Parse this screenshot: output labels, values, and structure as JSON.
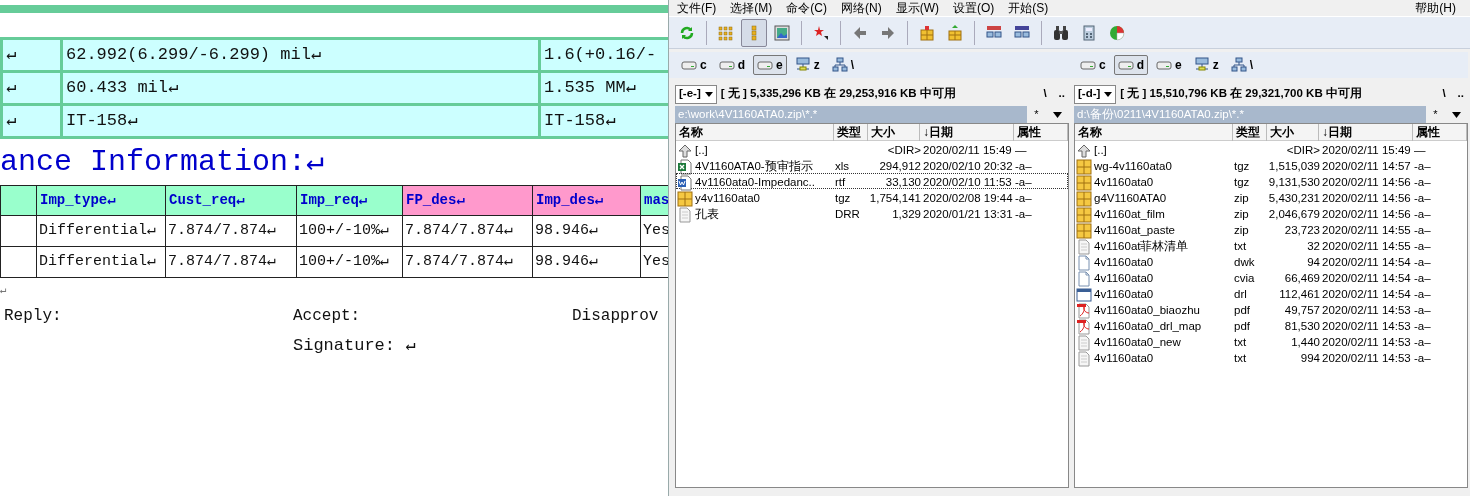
{
  "document": {
    "spec_rows": [
      {
        "cells": [
          "↵",
          "62.992(6.299/-6.299)  mil↵",
          "1.6(+0.16/-"
        ]
      },
      {
        "cells": [
          "↵",
          "60.433 mil↵",
          "1.535 MM↵"
        ]
      },
      {
        "cells": [
          "↵",
          "IT-158↵",
          "IT-158↵"
        ]
      }
    ],
    "heading": "ance Information:↵",
    "imp_table": {
      "columns": [
        {
          "label": "Imp_type↵",
          "color": "#99ffcc"
        },
        {
          "label": "Cust_req↵",
          "color": "#99ffcc"
        },
        {
          "label": "Imp_req↵",
          "color": "#99ffcc"
        },
        {
          "label": "FP_des↵",
          "color": "#ff99cc"
        },
        {
          "label": "Imp_des↵",
          "color": "#ff99cc"
        },
        {
          "label": "mas",
          "color": "#99ffcc"
        }
      ],
      "rows": [
        [
          "Differential↵",
          "7.874/7.874↵",
          "100+/-10%↵",
          "7.874/7.874↵",
          "98.946↵",
          "Yes"
        ],
        [
          "Differential↵",
          "7.874/7.874↵",
          "100+/-10%↵",
          "7.874/7.874↵",
          "98.946↵",
          "Yes"
        ]
      ]
    },
    "blank_line": "↵",
    "reply": [
      "Reply:",
      "Accept:",
      "Disapprov"
    ],
    "signature": "Signature: ↵"
  },
  "file_manager": {
    "menu": [
      "文件(F)",
      "选择(M)",
      "命令(C)",
      "网络(N)",
      "显示(W)",
      "设置(O)",
      "开始(S)"
    ],
    "help_menu": "帮助(H)",
    "toolbar": [
      [
        {
          "kind": "refresh",
          "selected": false
        }
      ],
      [
        {
          "kind": "grid",
          "selected": false
        },
        {
          "kind": "list",
          "selected": true
        },
        {
          "kind": "picture",
          "selected": false
        }
      ],
      [
        {
          "kind": "star",
          "selected": false
        }
      ],
      [
        {
          "kind": "back",
          "selected": false
        },
        {
          "kind": "forward",
          "selected": false
        }
      ],
      [
        {
          "kind": "pack",
          "selected": false
        },
        {
          "kind": "unpack",
          "selected": false
        }
      ],
      [
        {
          "kind": "ftp",
          "selected": false
        },
        {
          "kind": "url",
          "selected": false
        }
      ],
      [
        {
          "kind": "binoculars",
          "selected": false
        },
        {
          "kind": "calculator",
          "selected": false
        },
        {
          "kind": "pie",
          "selected": false
        }
      ]
    ],
    "panes": [
      {
        "drives": [
          {
            "letter": "c",
            "kind": "disk",
            "selected": false
          },
          {
            "letter": "d",
            "kind": "disk",
            "selected": false
          },
          {
            "letter": "e",
            "kind": "disk",
            "selected": true
          },
          {
            "letter": "z",
            "kind": "netdrive",
            "selected": false
          },
          {
            "letter": "\\",
            "kind": "network",
            "selected": false
          }
        ],
        "drive_dropdown": "[-e-]",
        "free_space": "[ 无 ]  5,335,296 KB 在 29,253,916 KB 中可用",
        "root_button": "\\",
        "up_button": "..",
        "path": "e:\\work\\4V1160ATA0.zip\\*.*",
        "filter": "*",
        "columns": [
          "名称",
          "类型",
          "大小",
          "↓日期",
          "属性"
        ],
        "files": [
          {
            "kind": "up",
            "name": "[..]",
            "type": "<DIR>",
            "date": "2020/02/11 15:49",
            "attr": "—",
            "focused": false
          },
          {
            "kind": "xls",
            "name": "4V1160ATA0-预审指示",
            "type": "xls",
            "size": "294,912",
            "date": "2020/02/10 20:32",
            "attr": "-a–",
            "focused": false
          },
          {
            "kind": "rtf",
            "name": "4v1160ata0-Impedanc..",
            "type": "rtf",
            "size": "33,130",
            "date": "2020/02/10 11:53",
            "attr": "-a–",
            "focused": true
          },
          {
            "kind": "archive",
            "name": "y4v1160ata0",
            "type": "tgz",
            "size": "1,754,141",
            "date": "2020/02/08 19:44",
            "attr": "-a–",
            "focused": false
          },
          {
            "kind": "text",
            "name": "孔表",
            "type": "DRR",
            "size": "1,329",
            "date": "2020/01/21 13:31",
            "attr": "-a–",
            "focused": false
          }
        ]
      },
      {
        "drives": [
          {
            "letter": "c",
            "kind": "disk",
            "selected": false
          },
          {
            "letter": "d",
            "kind": "disk",
            "selected": true
          },
          {
            "letter": "e",
            "kind": "disk",
            "selected": false
          },
          {
            "letter": "z",
            "kind": "netdrive",
            "selected": false
          },
          {
            "letter": "\\",
            "kind": "network",
            "selected": false
          }
        ],
        "drive_dropdown": "[-d-]",
        "free_space": "[ 无 ]  15,510,796 KB 在 29,321,700 KB 中可用",
        "root_button": "\\",
        "up_button": "..",
        "path": "d:\\备份\\0211\\4V1160ATA0.zip\\*.*",
        "filter": "*",
        "columns": [
          "名称",
          "类型",
          "大小",
          "↓日期",
          "属性"
        ],
        "files": [
          {
            "kind": "up",
            "name": "[..]",
            "type": "<DIR>",
            "date": "2020/02/11 15:49",
            "attr": "—",
            "focused": false
          },
          {
            "kind": "archive",
            "name": "wg-4v1160ata0",
            "type": "tgz",
            "size": "1,515,039",
            "date": "2020/02/11 14:57",
            "attr": "-a–",
            "focused": false
          },
          {
            "kind": "archive",
            "name": "4v1160ata0",
            "type": "tgz",
            "size": "9,131,530",
            "date": "2020/02/11 14:56",
            "attr": "-a–",
            "focused": false
          },
          {
            "kind": "archive",
            "name": "g4V1160ATA0",
            "type": "zip",
            "size": "5,430,231",
            "date": "2020/02/11 14:56",
            "attr": "-a–",
            "focused": false
          },
          {
            "kind": "archive",
            "name": "4v1160at_film",
            "type": "zip",
            "size": "2,046,679",
            "date": "2020/02/11 14:56",
            "attr": "-a–",
            "focused": false
          },
          {
            "kind": "archive",
            "name": "4v1160at_paste",
            "type": "zip",
            "size": "23,723",
            "date": "2020/02/11 14:55",
            "attr": "-a–",
            "focused": false
          },
          {
            "kind": "text",
            "name": "4v1160at菲林清单",
            "type": "txt",
            "size": "32",
            "date": "2020/02/11 14:55",
            "attr": "-a–",
            "focused": false
          },
          {
            "kind": "file",
            "name": "4v1160ata0",
            "type": "dwk",
            "size": "94",
            "date": "2020/02/11 14:54",
            "attr": "-a–",
            "focused": false
          },
          {
            "kind": "file",
            "name": "4v1160ata0",
            "type": "cvia",
            "size": "66,469",
            "date": "2020/02/11 14:54",
            "attr": "-a–",
            "focused": false
          },
          {
            "kind": "window",
            "name": "4v1160ata0",
            "type": "drl",
            "size": "112,461",
            "date": "2020/02/11 14:54",
            "attr": "-a–",
            "focused": false
          },
          {
            "kind": "pdf",
            "name": "4v1160ata0_biaozhu",
            "type": "pdf",
            "size": "49,757",
            "date": "2020/02/11 14:53",
            "attr": "-a–",
            "focused": false
          },
          {
            "kind": "pdf",
            "name": "4v1160ata0_drl_map",
            "type": "pdf",
            "size": "81,530",
            "date": "2020/02/11 14:53",
            "attr": "-a–",
            "focused": false
          },
          {
            "kind": "text",
            "name": "4v1160ata0_new",
            "type": "txt",
            "size": "1,440",
            "date": "2020/02/11 14:53",
            "attr": "-a–",
            "focused": false
          },
          {
            "kind": "text",
            "name": "4v1160ata0",
            "type": "txt",
            "size": "994",
            "date": "2020/02/11 14:53",
            "attr": "-a–",
            "focused": false
          }
        ]
      }
    ]
  }
}
